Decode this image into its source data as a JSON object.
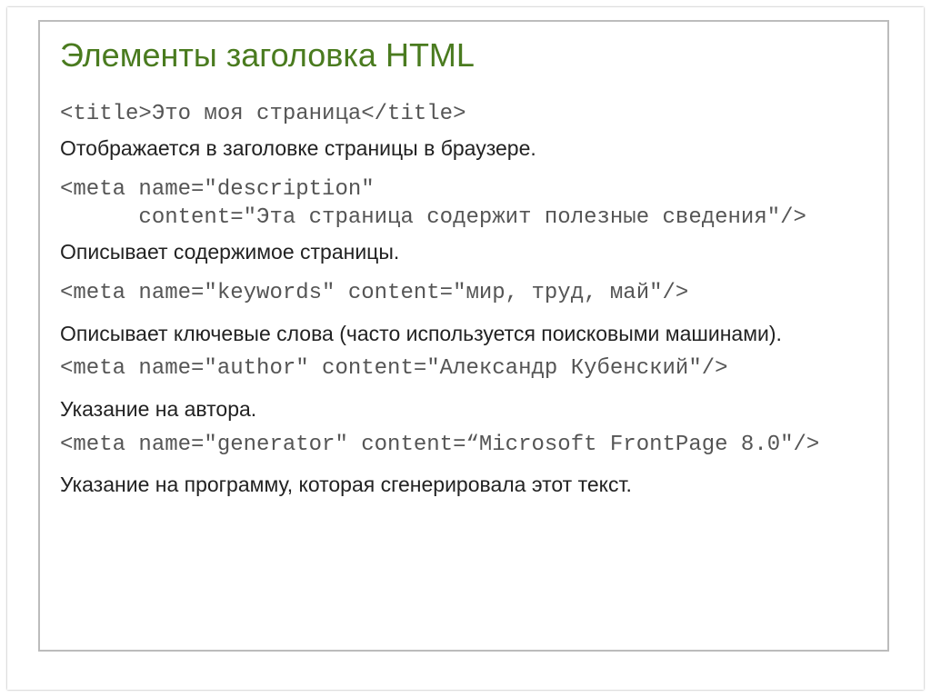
{
  "title": "Элементы заголовка HTML",
  "items": [
    {
      "code": "<title>Это моя страница</title>",
      "desc": "Отображается в заголовке страницы в браузере."
    },
    {
      "code": "<meta name=\"description\"\n      content=\"Эта страница содержит полезные сведения\"/>",
      "desc": "Описывает содержимое страницы."
    },
    {
      "code": "<meta name=\"keywords\" content=\"мир, труд, май\"/>",
      "desc": "Описывает ключевые слова (часто используется поисковыми машинами)."
    },
    {
      "code": "<meta name=\"author\" content=\"Александр Кубенский\"/>",
      "desc": "Указание на автора."
    },
    {
      "code": "<meta name=\"generator\" content=“Microsoft FrontPage 8.0\"/>",
      "desc": "Указание на программу, которая сгенерировала этот текст."
    }
  ]
}
